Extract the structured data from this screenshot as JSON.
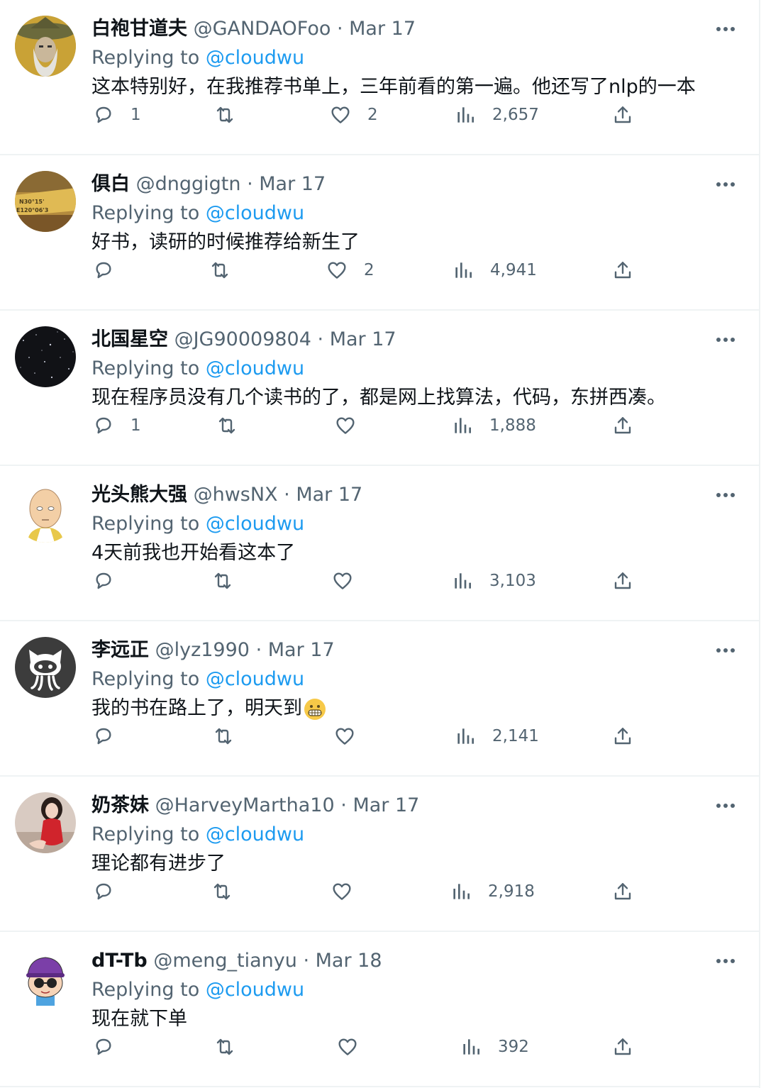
{
  "feed": {
    "replying_label": "Replying to",
    "reply_target": "@cloudwu",
    "tweets": [
      {
        "name": "白袍甘道夫",
        "handle": "@GANDAOFoo",
        "separator": "·",
        "date": "Mar 17",
        "text": "这本特别好，在我推荐书单上，三年前看的第一遍。他还写了nlp的一本",
        "replies": "1",
        "retweets": "",
        "likes": "2",
        "views": "2,657",
        "avatar_icon": "wizard-avatar-icon"
      },
      {
        "name": "俱白",
        "handle": "@dnggigtn",
        "separator": "·",
        "date": "Mar 17",
        "text": "好书，读研的时候推荐给新生了",
        "replies": "",
        "retweets": "",
        "likes": "2",
        "views": "4,941",
        "avatar_icon": "coordinates-avatar-icon",
        "avatar_text": [
          "N30°15'",
          "E120°06'3"
        ]
      },
      {
        "name": "北国星空",
        "handle": "@JG90009804",
        "separator": "·",
        "date": "Mar 17",
        "text": "现在程序员没有几个读书的了，都是网上找算法，代码，东拼西凑。",
        "replies": "1",
        "retweets": "",
        "likes": "",
        "views": "1,888",
        "avatar_icon": "starry-sky-avatar-icon"
      },
      {
        "name": "光头熊大强",
        "handle": "@hwsNX",
        "separator": "·",
        "date": "Mar 17",
        "text": "4天前我也开始看这本了",
        "replies": "",
        "retweets": "",
        "likes": "",
        "views": "3,103",
        "avatar_icon": "bald-hero-avatar-icon"
      },
      {
        "name": "李远正",
        "handle": "@lyz1990",
        "separator": "·",
        "date": "Mar 17",
        "text": "我的书在路上了，明天到",
        "emoji": "grimacing-face-emoji-icon",
        "replies": "",
        "retweets": "",
        "likes": "",
        "views": "2,141",
        "avatar_icon": "octocat-avatar-icon"
      },
      {
        "name": "奶茶妹",
        "handle": "@HarveyMartha10",
        "separator": "·",
        "date": "Mar 17",
        "text": "理论都有进步了",
        "replies": "",
        "retweets": "",
        "likes": "",
        "views": "2,918",
        "avatar_icon": "woman-red-dress-avatar-icon"
      },
      {
        "name": "dT-Tb",
        "handle": "@meng_tianyu",
        "separator": "·",
        "date": "Mar 18",
        "text": "现在就下单",
        "replies": "",
        "retweets": "",
        "likes": "",
        "views": "392",
        "avatar_icon": "cartoon-purple-hat-avatar-icon"
      }
    ]
  },
  "colors": {
    "text_primary": "#0f1419",
    "text_secondary": "#536471",
    "accent_blue": "#1d9bf0",
    "divider": "#eff3f4"
  },
  "icons": {
    "reply": "reply-icon",
    "retweet": "retweet-icon",
    "like": "heart-icon",
    "views": "views-chart-icon",
    "share": "share-icon",
    "more": "more-dots-icon"
  }
}
